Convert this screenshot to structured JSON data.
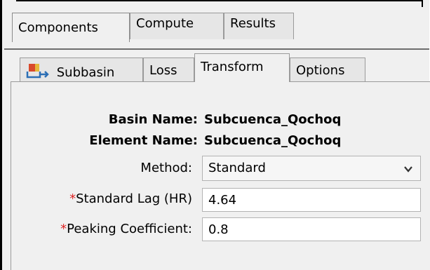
{
  "outer_tabs": [
    {
      "label": "Components",
      "active": true
    },
    {
      "label": "Compute",
      "active": false
    },
    {
      "label": "Results",
      "active": false
    }
  ],
  "inner_tabs": [
    {
      "label": "Subbasin",
      "icon": "subbasin-icon",
      "active": false
    },
    {
      "label": "Loss",
      "active": false
    },
    {
      "label": "Transform",
      "active": true
    },
    {
      "label": "Options",
      "active": false
    }
  ],
  "form": {
    "basin_name_label": "Basin Name:",
    "basin_name_value": "Subcuenca_Qochoq",
    "element_name_label": "Element Name:",
    "element_name_value": "Subcuenca_Qochoq",
    "method_label": "Method:",
    "method_value": "Standard",
    "required_marker": "*",
    "standard_lag_label": "Standard Lag (HR)",
    "standard_lag_value": "4.64",
    "peaking_coefficient_label": "Peaking Coefficient:",
    "peaking_coefficient_value": "0.8"
  },
  "colors": {
    "required": "#d22222",
    "panel_bg": "#f0f0f0"
  }
}
